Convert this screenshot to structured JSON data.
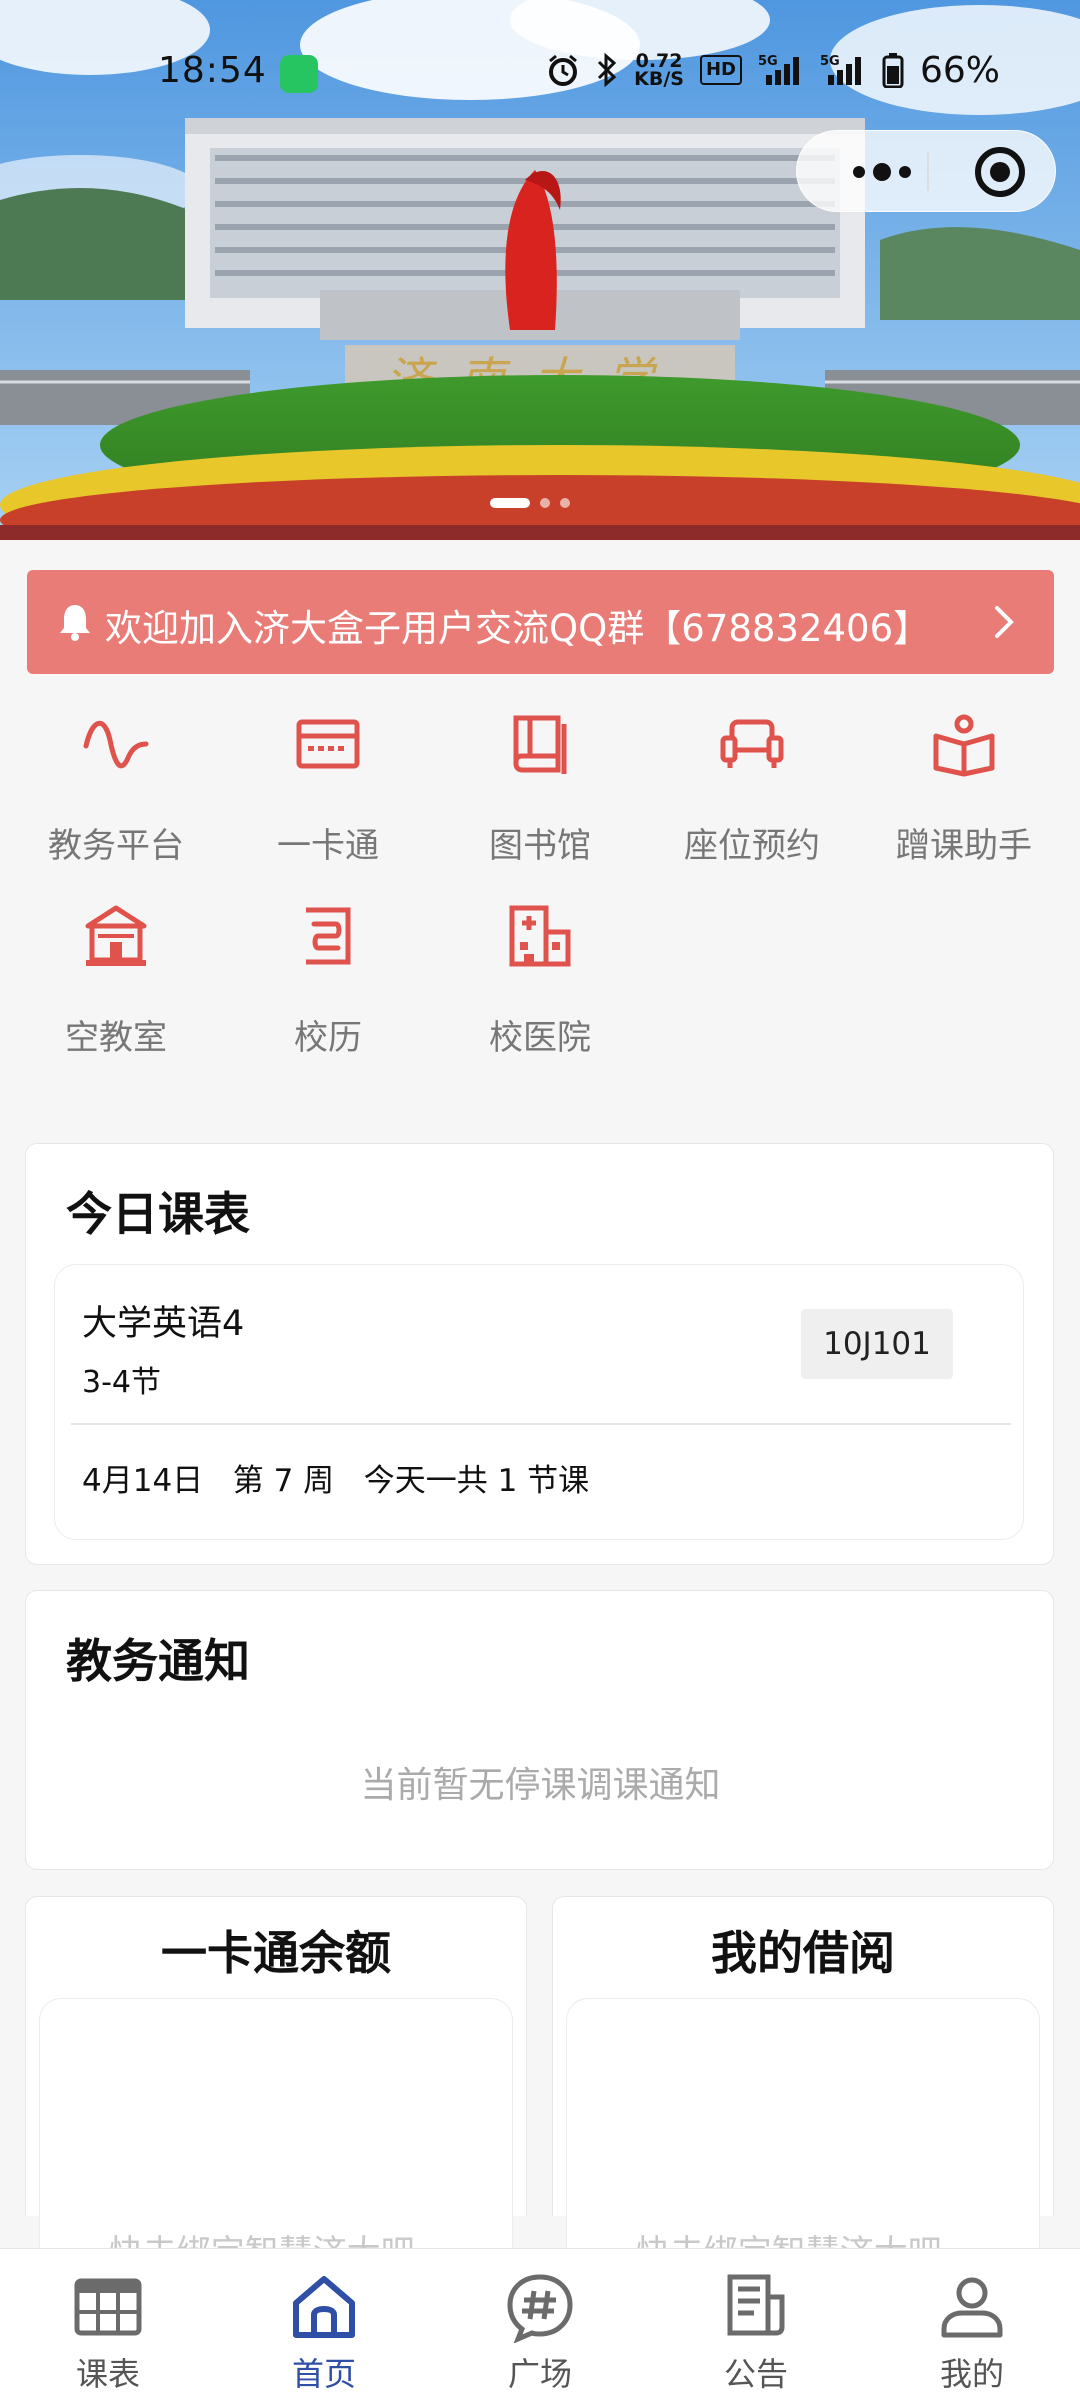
{
  "status_bar": {
    "time": "18:54",
    "net_speed_value": "0.72",
    "net_speed_unit": "KB/S",
    "hd_label": "HD",
    "sim1_label": "5G",
    "sim2_label": "5G",
    "battery_text": "66%"
  },
  "banner": {
    "sign_text": "济南大学",
    "slides_count": 3,
    "active_slide": 1
  },
  "notice": {
    "text": "欢迎加入济大盒子用户交流QQ群【678832406】"
  },
  "grid": {
    "items": [
      {
        "label": "教务平台",
        "icon": "wave-icon"
      },
      {
        "label": "一卡通",
        "icon": "card-icon"
      },
      {
        "label": "图书馆",
        "icon": "book-icon"
      },
      {
        "label": "座位预约",
        "icon": "sofa-icon"
      },
      {
        "label": "蹭课助手",
        "icon": "open-book-icon"
      },
      {
        "label": "空教室",
        "icon": "school-building-icon"
      },
      {
        "label": "校历",
        "icon": "calendar-icon"
      },
      {
        "label": "校医院",
        "icon": "hospital-icon"
      }
    ]
  },
  "schedule": {
    "title": "今日课表",
    "course": {
      "name": "大学英语4",
      "section": "3-4节",
      "room": "10J101"
    },
    "footer": "4月14日   第 7 周   今天一共 1 节课"
  },
  "notices": {
    "title": "教务通知",
    "empty_text": "当前暂无停课调课通知"
  },
  "card_balance": {
    "title": "一卡通余额",
    "hint": "快去绑定智慧济大吧~"
  },
  "borrow": {
    "title": "我的借阅",
    "hint": "快去绑定智慧济大吧~"
  },
  "tabbar": {
    "items": [
      {
        "label": "课表",
        "icon": "table-icon"
      },
      {
        "label": "首页",
        "icon": "home-icon"
      },
      {
        "label": "广场",
        "icon": "hashtag-icon"
      },
      {
        "label": "公告",
        "icon": "announcement-icon"
      },
      {
        "label": "我的",
        "icon": "user-icon"
      }
    ],
    "active_index": 1
  },
  "colors": {
    "accent_red": "#e0524c",
    "notice_bg": "#ea7c78",
    "tab_active": "#2f4fa6",
    "tab_inactive": "#6b6b6b"
  }
}
